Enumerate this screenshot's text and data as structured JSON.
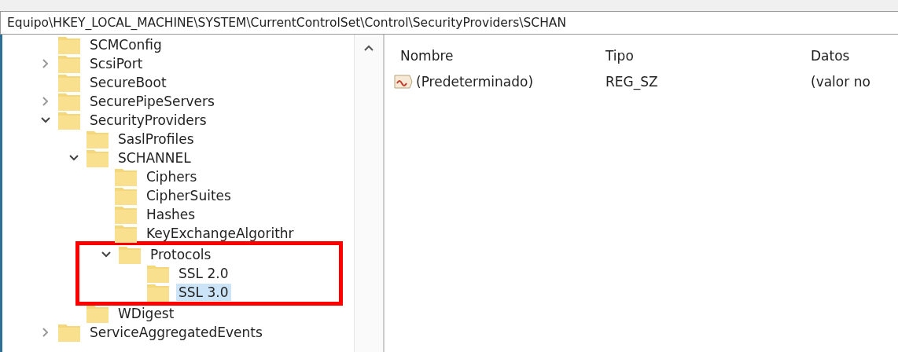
{
  "address_bar": {
    "path": "Equipo\\HKEY_LOCAL_MACHINE\\SYSTEM\\CurrentControlSet\\Control\\SecurityProviders\\SCHAN"
  },
  "tree": [
    {
      "name": "SCMConfig",
      "selected": false
    },
    {
      "name": "ScsiPort",
      "selected": false,
      "expanded": false
    },
    {
      "name": "SecureBoot",
      "selected": false
    },
    {
      "name": "SecurePipeServers",
      "selected": false,
      "expanded": false
    },
    {
      "name": "SecurityProviders",
      "selected": false,
      "expanded": true,
      "children": [
        {
          "name": "SaslProfiles",
          "selected": false
        },
        {
          "name": "SCHANNEL",
          "selected": false,
          "expanded": true,
          "children": [
            {
              "name": "Ciphers",
              "selected": false
            },
            {
              "name": "CipherSuites",
              "selected": false
            },
            {
              "name": "Hashes",
              "selected": false
            },
            {
              "name": "KeyExchangeAlgorithr",
              "selected": false
            },
            {
              "name": "Protocols",
              "selected": false,
              "expanded": true,
              "highlighted": true,
              "children": [
                {
                  "name": "SSL 2.0",
                  "selected": false
                },
                {
                  "name": "SSL 3.0",
                  "selected": true
                }
              ]
            }
          ]
        },
        {
          "name": "WDigest",
          "selected": false
        }
      ]
    },
    {
      "name": "ServiceAggregatedEvents",
      "selected": false,
      "expanded": false
    }
  ],
  "values": {
    "columns": [
      "Nombre",
      "Tipo",
      "Datos"
    ],
    "rows": [
      {
        "kind": "string",
        "cells": [
          "(Predeterminado)",
          "REG_SZ",
          "(valor no"
        ]
      }
    ]
  }
}
